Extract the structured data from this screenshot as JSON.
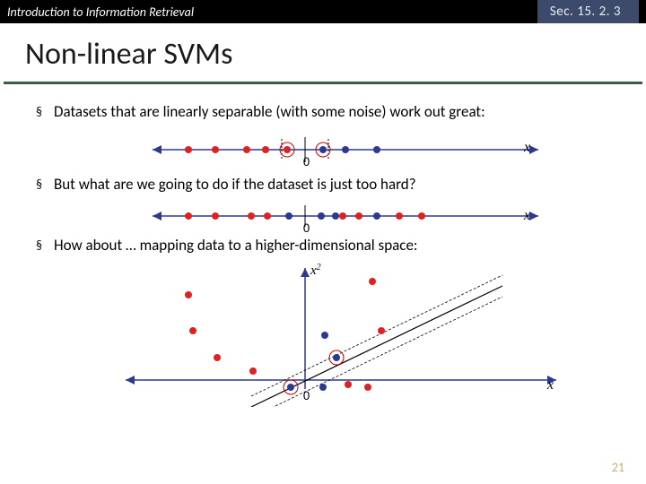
{
  "header": {
    "left": "Introduction to Information Retrieval",
    "right": "Sec. 15. 2. 3"
  },
  "title": "Non-linear SVMs",
  "bullets": {
    "b1": "Datasets that are linearly separable (with some noise) work out great:",
    "b2": "But what are we going to do if the dataset is just too hard?",
    "b3": "How about … mapping data to a higher-dimensional space:"
  },
  "labels": {
    "zero": "0",
    "x": "x",
    "x2": "x",
    "x2_sup": "2"
  },
  "page": "21",
  "chart_data": [
    {
      "type": "scatter",
      "title": "linearly separable 1D",
      "red_x": [
        -130,
        -100,
        -65,
        -44,
        -20
      ],
      "blue_x": [
        20,
        45,
        80
      ],
      "support_vectors_x": [
        -20,
        20
      ],
      "xlabel": "x"
    },
    {
      "type": "scatter",
      "title": "non-separable 1D",
      "red_x": [
        -130,
        -100,
        -60,
        -42,
        42,
        60,
        105,
        130
      ],
      "blue_x": [
        -18,
        18,
        34,
        80
      ],
      "xlabel": "x"
    },
    {
      "type": "scatter",
      "title": "mapped to 2D (x, x^2)",
      "red_points": [
        [
          -130,
          95
        ],
        [
          -125,
          55
        ],
        [
          -98,
          25
        ],
        [
          -58,
          10
        ],
        [
          75,
          110
        ],
        [
          85,
          55
        ],
        [
          48,
          -5
        ],
        [
          70,
          -8
        ]
      ],
      "blue_points": [
        [
          -16,
          -8
        ],
        [
          20,
          -8
        ],
        [
          35,
          25
        ],
        [
          22,
          50
        ]
      ],
      "support_vectors": [
        [
          -16,
          -8
        ],
        [
          35,
          25
        ]
      ],
      "xlabel": "x",
      "ylabel": "x^2"
    }
  ]
}
